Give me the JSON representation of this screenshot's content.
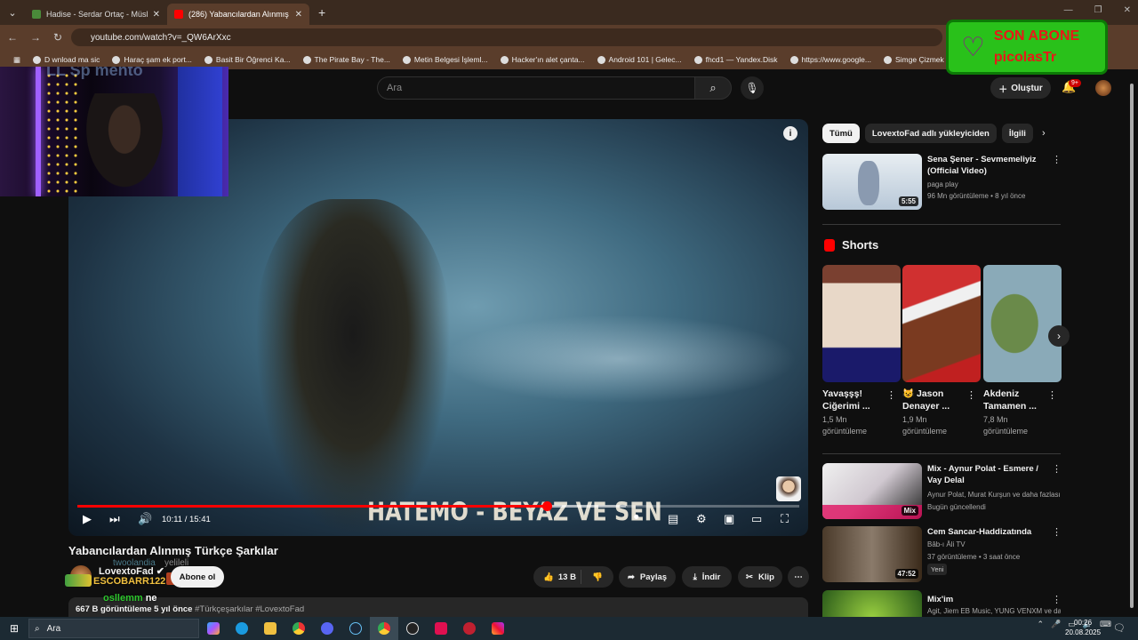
{
  "browser": {
    "tabs": [
      {
        "title": "Hadise - Serdar Ortaç - Müslüm",
        "active": false
      },
      {
        "title": "(286) Yabancılardan Alınmış Türk",
        "active": true
      }
    ],
    "new_tab": "+",
    "url": "youtube.com/watch?v=_QW6ArXxc",
    "bookmarks": [
      "D wnload ma sic",
      "Haraç şam ek port...",
      "Basit Bir Öğrenci Ka...",
      "The Pirate Bay - The...",
      "Metin Belgesi İşleml...",
      "Hacker'ın alet çanta...",
      "Android 101 | Gelec...",
      "fhcd1 — Yandex.Disk",
      "https://www.google...",
      "Simge Çizmek ve Ka..."
    ],
    "more_bookmarks": "»"
  },
  "overlay": {
    "title": "SON ABONE",
    "name": "picolasTr",
    "webcam_text": "LL Sp mento"
  },
  "header": {
    "search_placeholder": "Ara",
    "create_label": "Oluştur",
    "notification_count": "9+"
  },
  "player": {
    "video_text": "HATEMO - BEYAZ VE SEN",
    "info": "i",
    "current_time": "10:11",
    "duration": "15:41",
    "time_display": "10:11 / 15:41",
    "progress": 0.65,
    "buffered": 0.76
  },
  "video": {
    "title": "Yabancılardan Alınmış Türkçe Şarkılar",
    "channel": "LovextoFad",
    "channel_overlay": "twoolandia",
    "channel_sub": "yelileli",
    "donor": "ESCOBARR122",
    "subscribe": "Abone ol",
    "likes": "13 B",
    "share": "Paylaş",
    "download": "İndir",
    "clip": "Klip",
    "chat_user": "osllemm",
    "chat_msg": "ne",
    "views": "667 B görüntüleme",
    "age": "5 yıl önce",
    "tags": "#Türkçeşarkılar #LovextoFad"
  },
  "chips": [
    "Tümü",
    "LovextoFad adlı yükleyiciden",
    "İlgili"
  ],
  "recommendations": [
    {
      "title": "Sena Şener - Sevmemeliyiz (Official Video)",
      "channel": "paga play",
      "meta": "96 Mn görüntüleme • 8 yıl önce",
      "duration": "5:55"
    },
    {
      "title": "Mix - Aynur Polat - Esmere / Vay Delal",
      "channel": "Aynur Polat, Murat Kurşun ve daha fazlası",
      "meta": "Bugün güncellendi",
      "duration": "Mix"
    },
    {
      "title": "Cem Sancar-Haddizatında",
      "channel": "Bâb-ı Âli TV",
      "meta": "37 görüntüleme • 3 saat önce",
      "badge": "Yeni",
      "duration": "47:52"
    },
    {
      "title": "Mix'im",
      "channel": "Agit, Jiem EB Music, YUNG VENXM ve da...",
      "meta": "",
      "duration": ""
    }
  ],
  "shorts": {
    "heading": "Shorts",
    "items": [
      {
        "title": "Yavaşşş! Ciğerimi ...",
        "views": "1,5 Mn",
        "unit": "görüntüleme"
      },
      {
        "title": "😺 Jason Denayer ...",
        "views": "1,9 Mn",
        "unit": "görüntüleme"
      },
      {
        "title": "Akdeniz Tamamen ...",
        "views": "7,8 Mn",
        "unit": "görüntüleme"
      }
    ]
  },
  "taskbar": {
    "search": "Ara",
    "time": "00:26",
    "date": "20.08.2025"
  },
  "colors": {
    "accent": "#ff0000",
    "overlay_bg": "#29c11a",
    "overlay_text": "#e81818"
  }
}
